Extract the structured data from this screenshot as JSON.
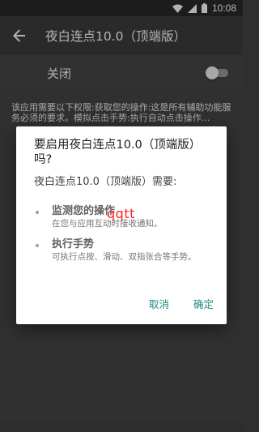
{
  "status_bar": {
    "time": "10:08",
    "icons": [
      "wifi-icon",
      "signal-icon",
      "battery-icon"
    ]
  },
  "app_bar": {
    "title": "夜白连点10.0（顶端版）",
    "back_icon": "arrow-left-icon"
  },
  "toggle": {
    "label": "关闭",
    "state": "off"
  },
  "description": "该应用需要以下权限:获取您的操作:这是所有辅助功能服务必须的要求。模拟点击手势:执行自动点击操作...",
  "dialog": {
    "title": "要启用夜白连点10.0（顶端版）吗?",
    "subtitle": "夜白连点10.0（顶端版）需要:",
    "permissions": [
      {
        "title": "监测您的操作",
        "desc": "在您与应用互动时接收通知。"
      },
      {
        "title": "执行手势",
        "desc": "可执行点按、滑动、双指张合等手势。"
      }
    ],
    "watermark": "qqtt",
    "cancel_label": "取消",
    "confirm_label": "确定"
  },
  "colors": {
    "accent": "#1f8a82",
    "watermark": "#ff2020"
  }
}
